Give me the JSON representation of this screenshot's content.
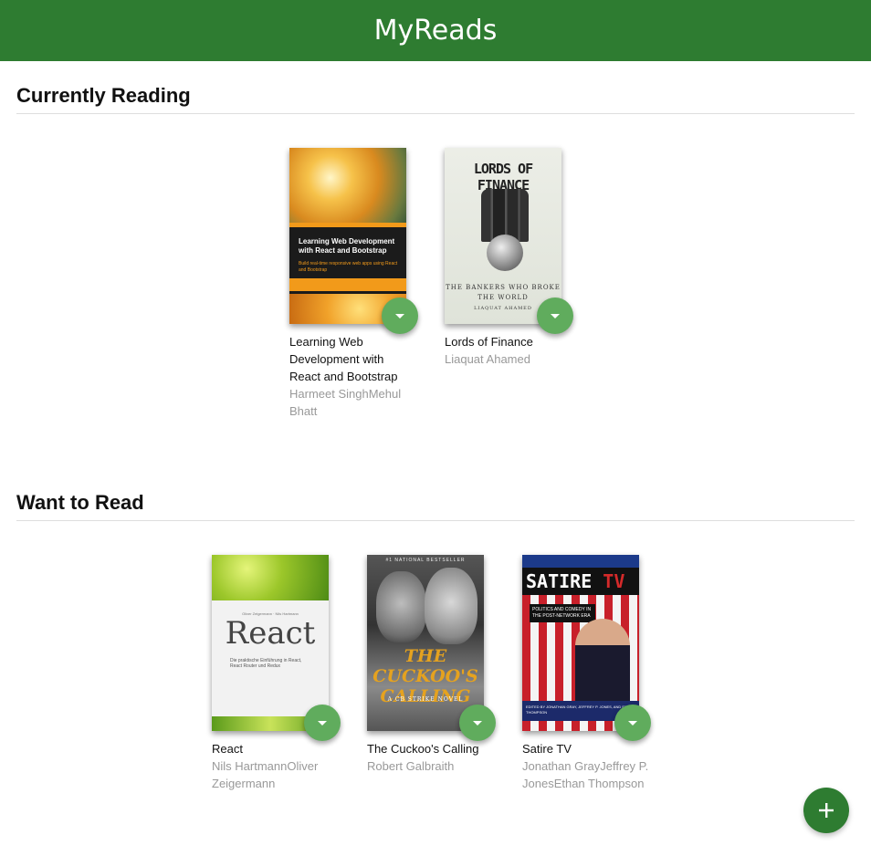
{
  "app": {
    "title": "MyReads"
  },
  "shelves": [
    {
      "title": "Currently Reading",
      "books": [
        {
          "title": "Learning Web Development with React and Bootstrap",
          "authors": "Harmeet SinghMehul Bhatt",
          "cover": {
            "heading": "Learning Web Development with React and Bootstrap",
            "subheading": "Build real-time responsive web apps using React and Bootstrap"
          }
        },
        {
          "title": "Lords of Finance",
          "authors": "Liaquat Ahamed",
          "cover": {
            "heading": "LORDS OF FINANCE",
            "subheading": "THE BANKERS WHO BROKE THE WORLD",
            "author": "LIAQUAT AHAMED"
          }
        }
      ]
    },
    {
      "title": "Want to Read",
      "books": [
        {
          "title": "React",
          "authors": "Nils HartmannOliver Zeigermann",
          "cover": {
            "authors_line": "Oliver Zeigermann · Nils Hartmann",
            "heading": "React",
            "subheading": "Die praktische Einführung in React, React Router und Redux"
          }
        },
        {
          "title": "The Cuckoo's Calling",
          "authors": "Robert Galbraith",
          "cover": {
            "top_line": "#1 NATIONAL BESTSELLER",
            "heading": "THE CUCKOO'S CALLING",
            "subheading": "A CB STRIKE NOVEL"
          }
        },
        {
          "title": "Satire TV",
          "authors": "Jonathan GrayJeffrey P. JonesEthan Thompson",
          "cover": {
            "heading_a": "SATIRE ",
            "heading_b": "TV",
            "subheading": "POLITICS AND COMEDY IN THE POST-NETWORK ERA",
            "footer": "EDITED BY JONATHAN GRAY, JEFFREY P. JONES, AND ETHAN THOMPSON"
          }
        }
      ]
    }
  ],
  "icons": {
    "shelf_changer": "triangle-down-icon",
    "add": "plus-icon"
  },
  "colors": {
    "header": "#2e7c31",
    "changer": "#60ac5d",
    "add_button": "#2e7c31"
  }
}
